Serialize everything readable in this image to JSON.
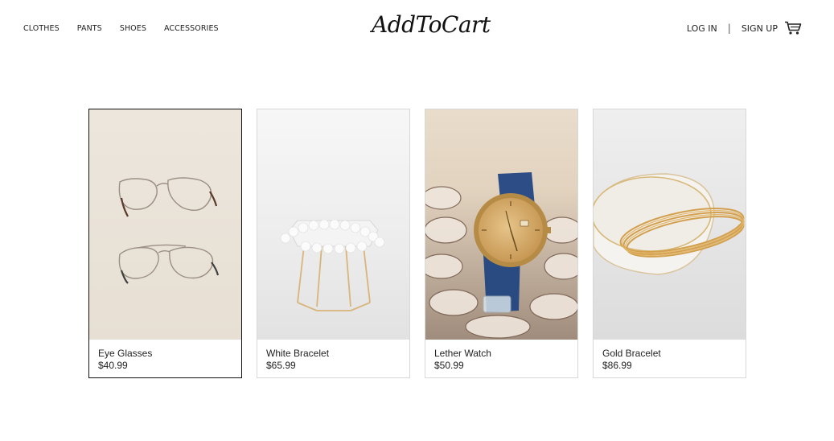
{
  "header": {
    "nav": [
      "CLOTHES",
      "PANTS",
      "SHOES",
      "ACCESSORIES"
    ],
    "logo": "AddToCart",
    "login_label": "LOG IN",
    "separator": "|",
    "signup_label": "SIGN UP",
    "cart_icon": "cart-icon"
  },
  "products": [
    {
      "name": "Eye Glasses",
      "price": "$40.99",
      "selected": true
    },
    {
      "name": "White Bracelet",
      "price": "$65.99",
      "selected": false
    },
    {
      "name": "Lether Watch",
      "price": "$50.99",
      "selected": false
    },
    {
      "name": "Gold Bracelet",
      "price": "$86.99",
      "selected": false
    }
  ],
  "colors": {
    "selected_border": "#111111",
    "card_border": "#d8d8d8",
    "text": "#222222"
  }
}
